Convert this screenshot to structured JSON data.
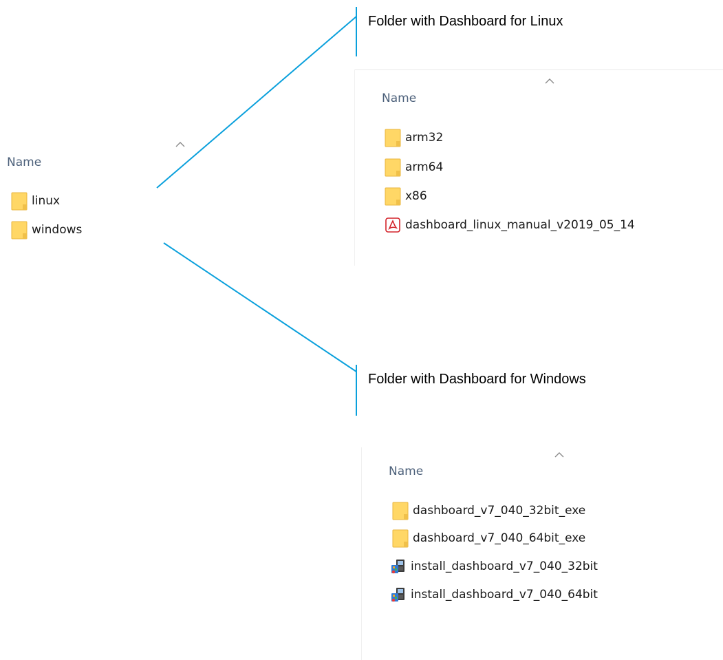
{
  "colors": {
    "accent_line": "#0aa0dc",
    "folder_fill": "#ffd766",
    "folder_tab": "#e8b53d",
    "header_text": "#4c607a"
  },
  "callouts": {
    "linux": "Folder with Dashboard for Linux",
    "windows": "Folder with Dashboard for Windows"
  },
  "root_pane": {
    "column_header": "Name",
    "items": [
      {
        "icon": "folder-icon",
        "label": "linux"
      },
      {
        "icon": "folder-icon",
        "label": "windows"
      }
    ]
  },
  "linux_pane": {
    "column_header": "Name",
    "items": [
      {
        "icon": "folder-icon",
        "label": "arm32"
      },
      {
        "icon": "folder-icon",
        "label": "arm64"
      },
      {
        "icon": "folder-icon",
        "label": "x86"
      },
      {
        "icon": "pdf-icon",
        "label": "dashboard_linux_manual_v2019_05_14"
      }
    ]
  },
  "windows_pane": {
    "column_header": "Name",
    "items": [
      {
        "icon": "folder-icon",
        "label": "dashboard_v7_040_32bit_exe"
      },
      {
        "icon": "folder-icon",
        "label": "dashboard_v7_040_64bit_exe"
      },
      {
        "icon": "installer-icon",
        "label": "install_dashboard_v7_040_32bit"
      },
      {
        "icon": "installer-icon",
        "label": "install_dashboard_v7_040_64bit"
      }
    ]
  }
}
